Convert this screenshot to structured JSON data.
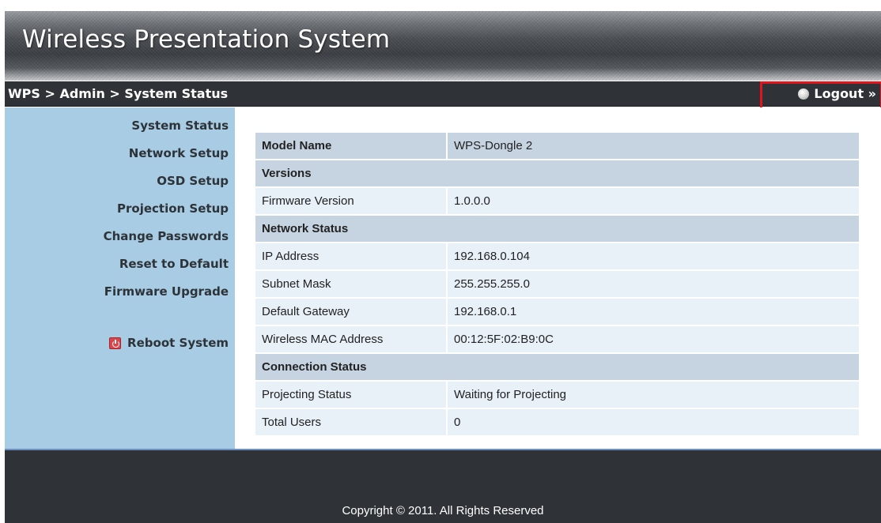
{
  "header": {
    "title": "Wireless Presentation System"
  },
  "breadcrumb": {
    "text": "WPS > Admin > System Status",
    "logout_label": "Logout »"
  },
  "sidebar": {
    "items": [
      {
        "label": "System Status"
      },
      {
        "label": "Network Setup"
      },
      {
        "label": "OSD Setup"
      },
      {
        "label": "Projection Setup"
      },
      {
        "label": "Change Passwords"
      },
      {
        "label": "Reset to Default"
      },
      {
        "label": "Firmware Upgrade"
      }
    ],
    "reboot_label": "Reboot System"
  },
  "status": {
    "model": {
      "label": "Model Name",
      "value": "WPS-Dongle 2"
    },
    "versions_header": "Versions",
    "firmware": {
      "label": "Firmware Version",
      "value": "1.0.0.0"
    },
    "network_header": "Network Status",
    "network": [
      {
        "label": "IP Address",
        "value": "192.168.0.104"
      },
      {
        "label": "Subnet Mask",
        "value": "255.255.255.0"
      },
      {
        "label": "Default Gateway",
        "value": "192.168.0.1"
      },
      {
        "label": "Wireless MAC Address",
        "value": "00:12:5F:02:B9:0C"
      }
    ],
    "connection_header": "Connection Status",
    "connection": [
      {
        "label": "Projecting Status",
        "value": "Waiting for Projecting"
      },
      {
        "label": "Total Users",
        "value": "0"
      }
    ]
  },
  "footer": {
    "copyright": "Copyright © 2011. All Rights Reserved"
  },
  "colors": {
    "sidebar_bg": "#a8cce3",
    "bar_bg": "#2f3338",
    "highlight": "#e3141c",
    "row_bg": "#e8f0f8",
    "header_row_bg": "#c6d4e2"
  },
  "icons": {
    "logout": "logout-bullet-icon",
    "reboot": "power-icon"
  }
}
